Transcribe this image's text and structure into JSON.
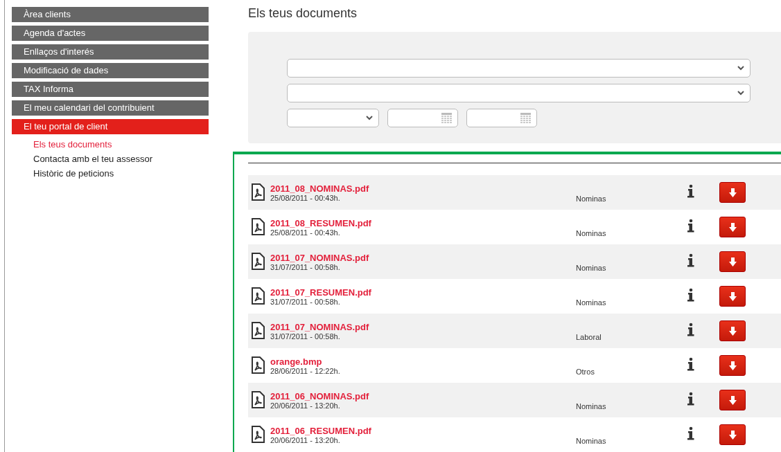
{
  "sidebar": {
    "items": [
      {
        "label": "Àrea clients",
        "selected": false
      },
      {
        "label": "Agenda d'actes",
        "selected": false
      },
      {
        "label": "Enllaços d'interés",
        "selected": false
      },
      {
        "label": "Modificació de dades",
        "selected": false
      },
      {
        "label": "TAX Informa",
        "selected": false
      },
      {
        "label": "El meu calendari del contribuient",
        "selected": false
      },
      {
        "label": "El teu portal de client",
        "selected": true,
        "children": [
          {
            "label": "Els teus documents",
            "selected": true
          },
          {
            "label": "Contacta amb el teu assessor",
            "selected": false
          },
          {
            "label": "Històric de peticions",
            "selected": false
          }
        ]
      }
    ]
  },
  "page_title": "Els teus documents",
  "filters": [
    {
      "kind": "wide_select"
    },
    {
      "kind": "wide_select"
    },
    {
      "kind": "select"
    },
    {
      "kind": "date"
    },
    {
      "kind": "date"
    }
  ],
  "documents": [
    {
      "name": "2011_08_NOMINAS.pdf",
      "date": "25/08/2011 - 00:43h.",
      "category": "Nominas"
    },
    {
      "name": "2011_08_RESUMEN.pdf",
      "date": "25/08/2011 - 00:43h.",
      "category": "Nominas"
    },
    {
      "name": "2011_07_NOMINAS.pdf",
      "date": "31/07/2011 - 00:58h.",
      "category": "Nominas"
    },
    {
      "name": "2011_07_RESUMEN.pdf",
      "date": "31/07/2011 - 00:58h.",
      "category": "Nominas"
    },
    {
      "name": "2011_07_NOMINAS.pdf",
      "date": "31/07/2011 - 00:58h.",
      "category": "Laboral"
    },
    {
      "name": "orange.bmp",
      "date": "28/06/2011 - 12:22h.",
      "category": "Otros"
    },
    {
      "name": "2011_06_NOMINAS.pdf",
      "date": "20/06/2011 - 13:20h.",
      "category": "Nominas"
    },
    {
      "name": "2011_06_RESUMEN.pdf",
      "date": "20/06/2011 - 13:20h.",
      "category": "Nominas"
    }
  ]
}
